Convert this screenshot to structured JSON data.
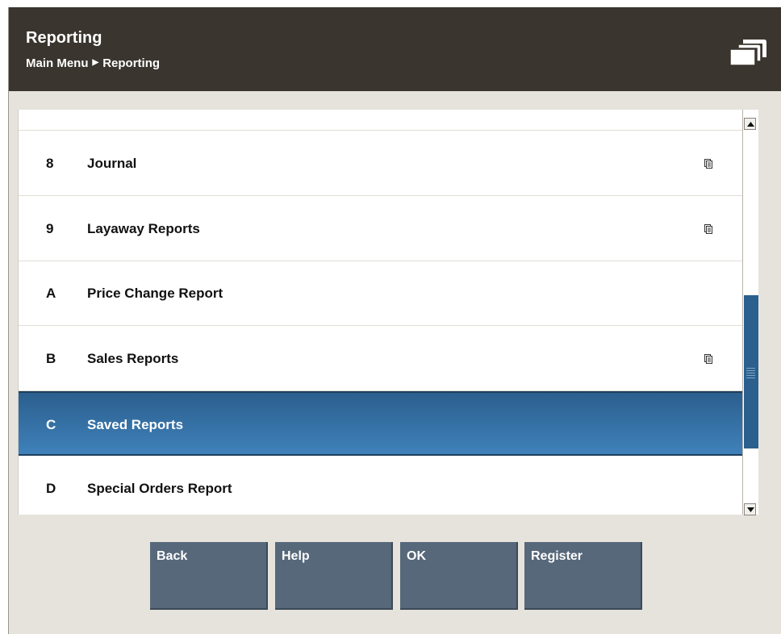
{
  "header": {
    "title": "Reporting",
    "breadcrumb": [
      "Main Menu",
      "Reporting"
    ],
    "icon": "stacked-pages-icon"
  },
  "menu": {
    "items": [
      {
        "key": "8",
        "label": "Journal",
        "has_submenu": true
      },
      {
        "key": "9",
        "label": "Layaway Reports",
        "has_submenu": true
      },
      {
        "key": "A",
        "label": "Price Change Report",
        "has_submenu": false
      },
      {
        "key": "B",
        "label": "Sales Reports",
        "has_submenu": true
      },
      {
        "key": "C",
        "label": "Saved Reports",
        "has_submenu": false,
        "selected": true
      },
      {
        "key": "D",
        "label": "Special Orders Report",
        "has_submenu": false
      }
    ],
    "selected_color": "#2b5f8e"
  },
  "buttons": {
    "back": "Back",
    "help": "Help",
    "ok": "OK",
    "register": "Register"
  }
}
